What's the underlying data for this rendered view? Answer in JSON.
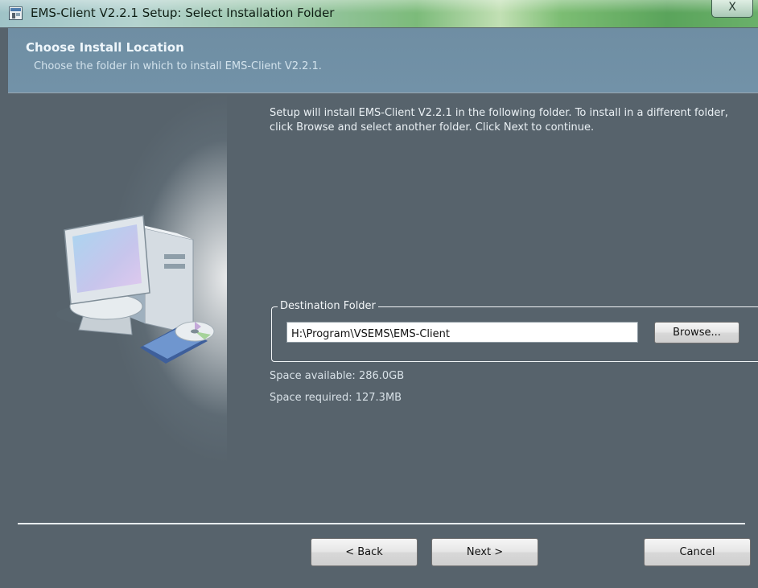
{
  "window": {
    "title": "EMS-Client V2.2.1 Setup: Select Installation Folder",
    "close_glyph": "X",
    "icon": "installer-app-icon"
  },
  "header": {
    "title": "Choose Install Location",
    "subtitle": "Choose the folder in which to install EMS-Client V2.2.1."
  },
  "body": {
    "description": "Setup will install EMS-Client V2.2.1 in the following folder. To install in a different folder, click Browse and select another folder. Click Next to continue.",
    "destination": {
      "legend": "Destination Folder",
      "path": "H:\\Program\\VSEMS\\EMS-Client",
      "browse_label": "Browse..."
    },
    "space_available": "Space available: 286.0GB",
    "space_required": "Space required: 127.3MB"
  },
  "footer": {
    "back_label": "< Back",
    "next_label": "Next >",
    "cancel_label": "Cancel"
  },
  "colors": {
    "body_bg": "#57636c",
    "header_bg": "#7292a8",
    "titlebar_accent": "#7cbb7a"
  },
  "icons": [
    "installer-app-icon",
    "close-icon",
    "computer-illustration"
  ]
}
